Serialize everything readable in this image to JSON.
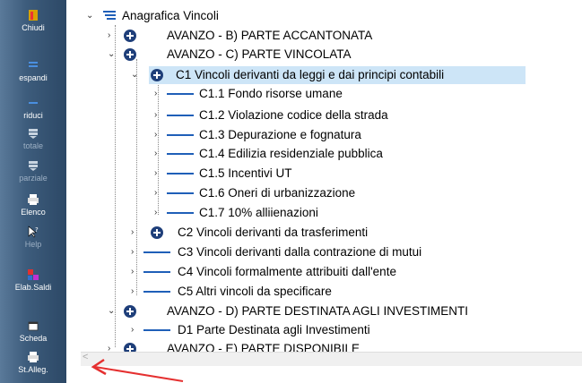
{
  "sidebar": {
    "chiudi": "Chiudi",
    "espandi": "espandi",
    "riduci": "riduci",
    "totale": "totale",
    "parziale": "parziale",
    "elenco": "Elenco",
    "help": "Help",
    "elab_saldi": "Elab.Saldi",
    "scheda": "Scheda",
    "st_alleg": "St.Alleg."
  },
  "tree": {
    "root": "Anagrafica Vincoli",
    "b": "AVANZO - B) PARTE ACCANTONATA",
    "c": "AVANZO - C) PARTE VINCOLATA",
    "c1": "C1   Vincoli derivanti da leggi e dai principi contabili",
    "c1_items": [
      "C1.1   Fondo risorse umane",
      "C1.2   Violazione codice della strada",
      "C1.3   Depurazione e fognatura",
      "C1.4   Edilizia residenziale pubblica",
      "C1.5   Incentivi UT",
      "C1.6   Oneri di urbanizzazione",
      "C1.7   10% alliienazioni"
    ],
    "c2": "C2   Vincoli derivanti da trasferimenti",
    "c3": "C3   Vincoli derivanti dalla contrazione di mutui",
    "c4": "C4   Vincoli formalmente attribuiti dall'ente",
    "c5": "C5   Altri vincoli da specificare",
    "d": "AVANZO - D) PARTE DESTINATA AGLI INVESTIMENTI",
    "d1": "D1   Parte Destinata agli Investimenti",
    "e": "AVANZO - E) PARTE DISPONIBILE"
  },
  "scroll_left": "<",
  "colors": {
    "accent": "#1f3f7a",
    "selection": "#cde5f7",
    "annotation": "#e53030"
  }
}
